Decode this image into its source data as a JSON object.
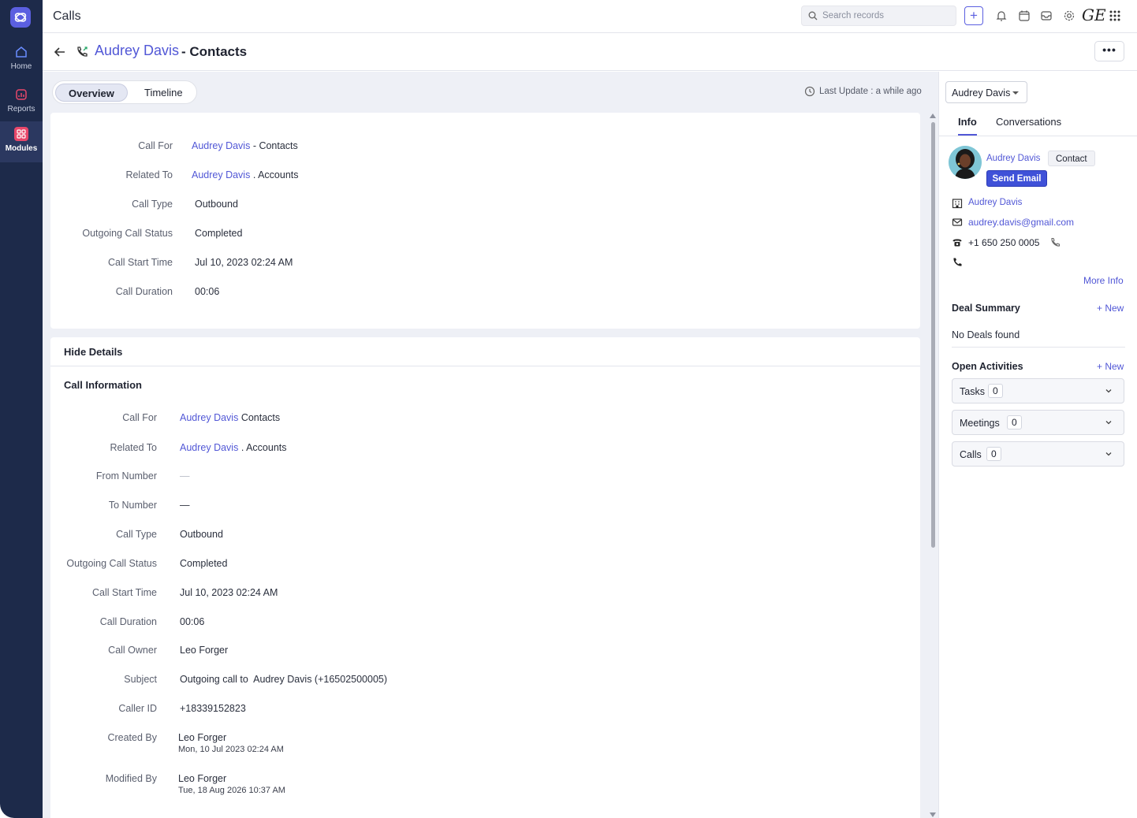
{
  "nav": {
    "items": [
      {
        "label": "Home"
      },
      {
        "label": "Reports"
      },
      {
        "label": "Modules"
      }
    ]
  },
  "topbar": {
    "title": "Calls",
    "search_placeholder": "Search records",
    "user_initials": "GE"
  },
  "record": {
    "name": "Audrey Davis",
    "module": "- Contacts"
  },
  "tabs": {
    "overview": "Overview",
    "timeline": "Timeline"
  },
  "last_update": "Last Update : a while ago",
  "summary": {
    "rows": [
      {
        "label": "Call For",
        "link": "Audrey Davis",
        "suffix": " - Contacts"
      },
      {
        "label": "Related To",
        "link": "Audrey Davis",
        "suffix": " . Accounts"
      },
      {
        "label": "Call Type",
        "value": "Outbound"
      },
      {
        "label": "Outgoing Call Status",
        "value": "Completed"
      },
      {
        "label": "Call Start Time",
        "value": "Jul 10, 2023 02:24 AM"
      },
      {
        "label": "Call Duration",
        "value": "00:06"
      }
    ]
  },
  "details": {
    "toggle_label": "Hide Details",
    "section_title": "Call Information",
    "rows": [
      {
        "label": "Call For",
        "link": "Audrey Davis",
        "suffix": " Contacts"
      },
      {
        "label": "Related To",
        "link": "Audrey Davis",
        "suffix": " . Accounts"
      },
      {
        "label": "From Number",
        "value": "—"
      },
      {
        "label": "To Number",
        "value": "—"
      },
      {
        "label": "Call Type",
        "value": "Outbound"
      },
      {
        "label": "Outgoing Call Status",
        "value": "Completed"
      },
      {
        "label": "Call Start Time",
        "value": "Jul 10, 2023 02:24 AM"
      },
      {
        "label": "Call Duration",
        "value": "00:06"
      },
      {
        "label": "Call Owner",
        "value": "Leo Forger"
      },
      {
        "label": "Subject",
        "value": "Outgoing call to  Audrey Davis (+16502500005)"
      },
      {
        "label": "Caller ID",
        "value": "+18339152823"
      },
      {
        "label": "Created By",
        "value": "Leo Forger",
        "sub": "Mon, 10 Jul 2023 02:24 AM"
      },
      {
        "label": "Modified By",
        "value": "Leo Forger",
        "sub": "Tue, 18 Aug 2026 10:37 AM"
      }
    ]
  },
  "right": {
    "selector": "Audrey Davis",
    "tabs": {
      "info": "Info",
      "conversations": "Conversations"
    },
    "contact_name": "Audrey Davis",
    "contact_badge": "Contact",
    "send_email": "Send Email",
    "account": "Audrey Davis",
    "email": "audrey.davis@gmail.com",
    "phone": "+1 650 250 0005",
    "more_info": "More Info",
    "deal_summary": "Deal Summary",
    "new_label": "+ New",
    "no_deals": "No Deals found",
    "open_activities": "Open Activities",
    "activities": [
      {
        "label": "Tasks",
        "count": "0"
      },
      {
        "label": "Meetings",
        "count": "0"
      },
      {
        "label": "Calls",
        "count": "0"
      }
    ]
  },
  "colors": {
    "nav_bg": "#1d2a4a",
    "accent": "#5157d6",
    "button_blue": "#3f51d8",
    "main_bg": "#eef0f6"
  },
  "icons": [
    "app-logo-icon",
    "home-icon",
    "reports-icon",
    "modules-icon",
    "search-icon",
    "plus-icon",
    "bell-icon",
    "calendar-icon",
    "inbox-icon",
    "gear-icon",
    "apps-grid-icon",
    "back-arrow-icon",
    "outgoing-call-icon",
    "more-icon",
    "clock-icon",
    "building-icon",
    "mail-icon",
    "phone-icon",
    "chevron-down-icon"
  ]
}
